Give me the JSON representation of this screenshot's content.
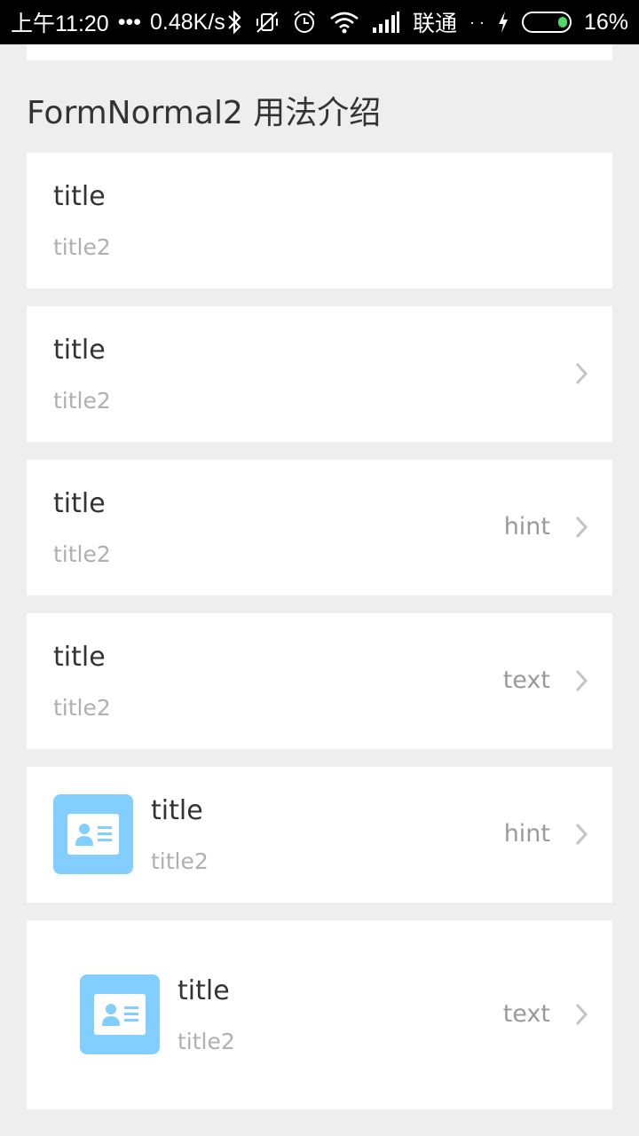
{
  "status_bar": {
    "time": "上午11:20",
    "dots": "•••",
    "speed": "0.48K/s",
    "carrier": "联通",
    "battery": "16%",
    "icons": [
      "bluetooth-icon",
      "vibrate-off-icon",
      "alarm-icon",
      "wifi-icon",
      "signal-icon",
      "charging-icon",
      "battery-icon"
    ]
  },
  "page": {
    "section_title": "FormNormal2 用法介绍"
  },
  "rows": [
    {
      "title": "title",
      "subtitle": "title2"
    },
    {
      "title": "title",
      "subtitle": "title2"
    },
    {
      "title": "title",
      "subtitle": "title2",
      "hint": "hint"
    },
    {
      "title": "title",
      "subtitle": "title2",
      "hint": "text"
    },
    {
      "title": "title",
      "subtitle": "title2",
      "hint": "hint"
    },
    {
      "title": "title",
      "subtitle": "title2",
      "hint": "text"
    }
  ],
  "colors": {
    "background": "#eeeeee",
    "card": "#ffffff",
    "title": "#333333",
    "subtitle": "#b0b0b0",
    "hint": "#9a9a9a",
    "avatar": "#82cfff"
  }
}
